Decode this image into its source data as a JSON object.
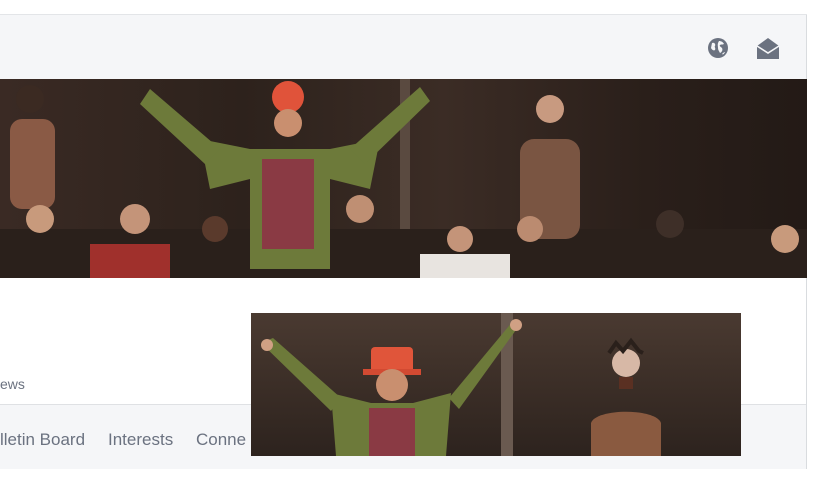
{
  "header": {
    "icons": [
      {
        "name": "globe-icon"
      },
      {
        "name": "envelope-open-icon"
      }
    ]
  },
  "profile": {
    "views_label": "ews"
  },
  "tabs": [
    {
      "label": "lletin Board"
    },
    {
      "label": "Interests"
    },
    {
      "label": "Conne"
    }
  ],
  "colors": {
    "topbar_bg": "#f5f6f8",
    "icon": "#6b7280",
    "tab_text": "#6b7280",
    "divider": "#d9dcdf"
  }
}
